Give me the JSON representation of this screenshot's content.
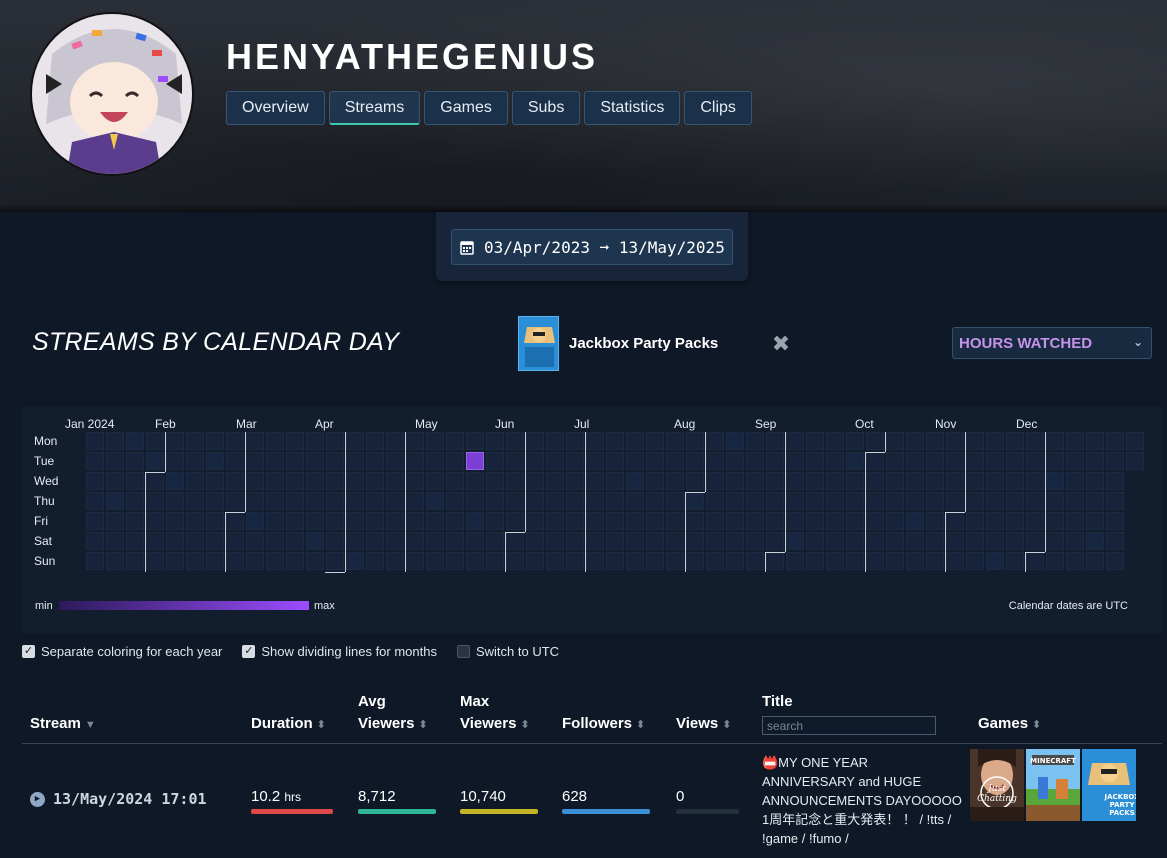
{
  "channel": {
    "name": "HENYATHEGENIUS"
  },
  "tabs": [
    "Overview",
    "Streams",
    "Games",
    "Subs",
    "Statistics",
    "Clips"
  ],
  "active_tab": "Streams",
  "date_range": {
    "label": "03/Apr/2023 ➞ 13/May/2025"
  },
  "section": {
    "title": "STREAMS BY CALENDAR DAY"
  },
  "game_filter": {
    "name": "Jackbox Party Packs",
    "clear_icon": "close-x-icon"
  },
  "metric_select": {
    "value": "HOURS WATCHED"
  },
  "heatmap": {
    "months": [
      "Jan 2024",
      "Feb",
      "Mar",
      "Apr",
      "May",
      "Jun",
      "Jul",
      "Aug",
      "Sep",
      "Oct",
      "Nov",
      "Dec"
    ],
    "days": [
      "Mon",
      "Tue",
      "Wed",
      "Thu",
      "Fri",
      "Sat",
      "Sun"
    ],
    "highlight": {
      "week": 19,
      "day": "Tue",
      "level": 1.0
    },
    "legend_min": "min",
    "legend_max": "max",
    "note": "Calendar dates are UTC"
  },
  "options": {
    "separate_coloring": {
      "label": "Separate coloring for each year",
      "checked": true
    },
    "month_lines": {
      "label": "Show dividing lines for months",
      "checked": true
    },
    "utc": {
      "label": "Switch to UTC",
      "checked": false
    }
  },
  "table": {
    "headers": {
      "stream": "Stream",
      "duration": "Duration",
      "avg_viewers_1": "Avg",
      "avg_viewers_2": "Viewers",
      "max_viewers_1": "Max",
      "max_viewers_2": "Viewers",
      "followers": "Followers",
      "views": "Views",
      "title": "Title",
      "games": "Games"
    },
    "search_placeholder": "search",
    "rows": [
      {
        "date": "13/May/2024 17:01",
        "duration": "10.2",
        "duration_unit": "hrs",
        "avg_viewers": "8,712",
        "max_viewers": "10,740",
        "followers": "628",
        "views": "0",
        "title": "📛MY ONE YEAR ANNIVERSARY and HUGE ANNOUNCEMENTS DAYOOOOO 1周年記念と重大発表！ ！ / !tts / !game / !fumo /",
        "games": [
          "Just Chatting",
          "Minecraft",
          "Jackbox Party Packs"
        ],
        "bar_levels": {
          "duration": 0.85,
          "avg_viewers": 1.0,
          "max_viewers": 1.0,
          "followers": 1.0,
          "views": 0.0
        }
      }
    ]
  },
  "colors": {
    "accent_tab": "#3ec9a8",
    "metric": "#c792ea",
    "heat_max": "#9b4dff",
    "bar_duration": "#e04848",
    "bar_avg": "#2fb594",
    "bar_max": "#c4b325",
    "bar_followers": "#3a8fd6"
  }
}
